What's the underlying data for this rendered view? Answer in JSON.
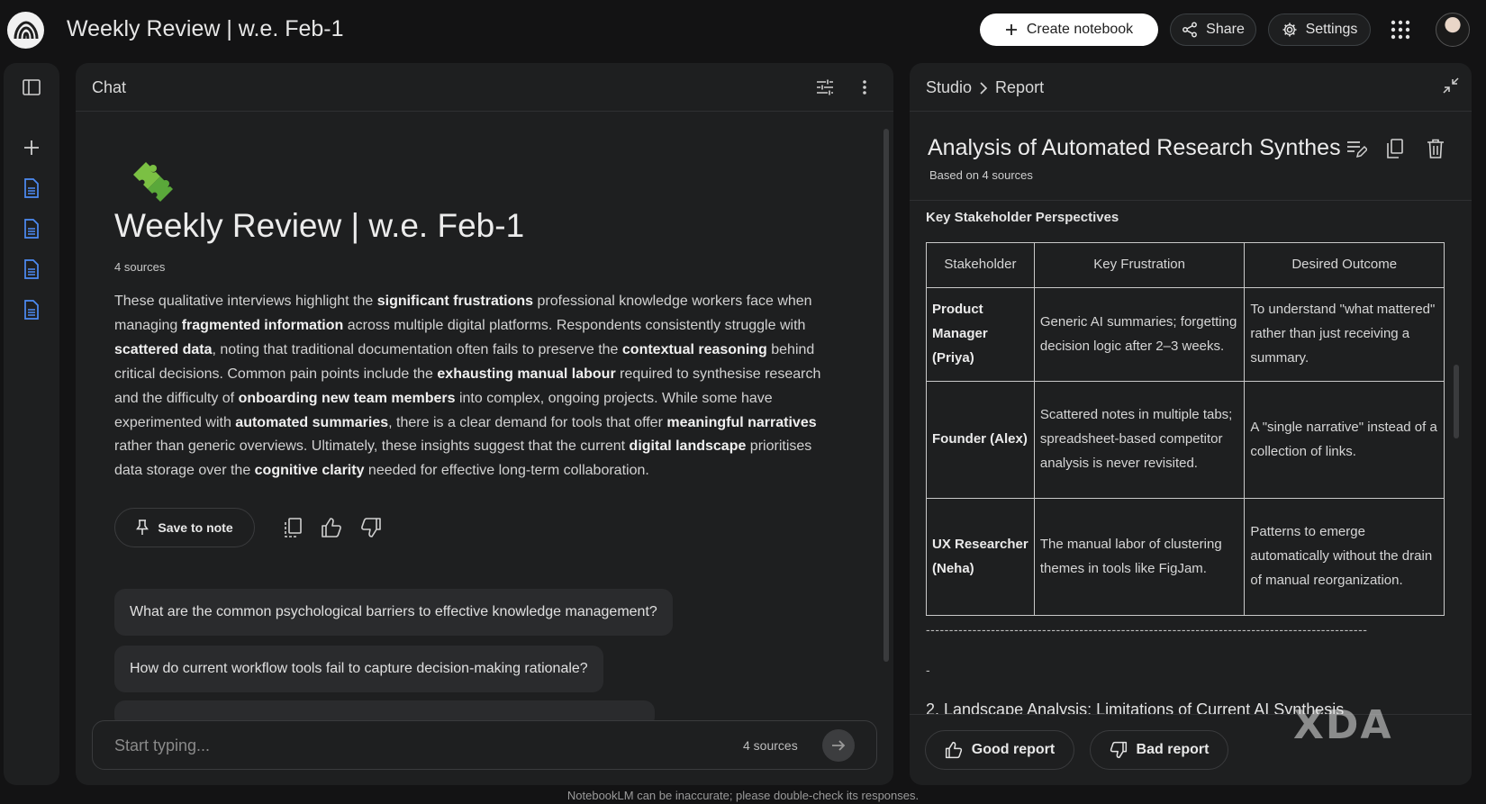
{
  "header": {
    "title": "Weekly Review |  w.e. Feb-1",
    "create_label": "Create notebook",
    "share_label": "Share",
    "settings_label": "Settings"
  },
  "chat": {
    "panel_title": "Chat",
    "notebook_title": "Weekly Review | w.e. Feb-1",
    "sources_count": "4 sources",
    "summary": [
      {
        "t": "These qualitative interviews highlight the "
      },
      {
        "t": "significant frustrations",
        "b": true
      },
      {
        "t": " professional knowledge workers face when managing "
      },
      {
        "t": "fragmented information",
        "b": true
      },
      {
        "t": " across multiple digital platforms. Respondents consistently struggle with "
      },
      {
        "t": "scattered data",
        "b": true
      },
      {
        "t": ", noting that traditional documentation often fails to preserve the "
      },
      {
        "t": "contextual reasoning",
        "b": true
      },
      {
        "t": " behind critical decisions. Common pain points include the "
      },
      {
        "t": "exhausting manual labour",
        "b": true
      },
      {
        "t": " required to synthesise research and the difficulty of "
      },
      {
        "t": "onboarding new team members",
        "b": true
      },
      {
        "t": " into complex, ongoing projects. While some have experimented with "
      },
      {
        "t": "automated summaries",
        "b": true
      },
      {
        "t": ", there is a clear demand for tools that offer "
      },
      {
        "t": "meaningful narratives",
        "b": true
      },
      {
        "t": " rather than generic overviews. Ultimately, these insights suggest that the current "
      },
      {
        "t": "digital landscape",
        "b": true
      },
      {
        "t": " prioritises data storage over the "
      },
      {
        "t": "cognitive clarity",
        "b": true
      },
      {
        "t": " needed for effective long-term collaboration."
      }
    ],
    "save_label": "Save to note",
    "suggestions": [
      "What are the common psychological barriers to effective knowledge management?",
      "How do current workflow tools fail to capture decision-making rationale?"
    ],
    "input_placeholder": "Start typing...",
    "input_sources": "4 sources"
  },
  "studio": {
    "crumb_root": "Studio",
    "crumb_current": "Report",
    "report_title": "Analysis of Automated Research Synthes",
    "based_on": "Based on 4 sources",
    "section_heading": "Key Stakeholder Perspectives",
    "table": {
      "headers": [
        "Stakeholder",
        "Key Frustration",
        "Desired Outcome"
      ],
      "rows": [
        [
          "Product Manager (Priya)",
          "Generic AI summaries; forgetting decision logic after 2–3 weeks.",
          "To understand \"what mattered\" rather than just receiving a summary."
        ],
        [
          "Founder (Alex)",
          "Scattered notes in multiple tabs; spreadsheet-based competitor analysis is never revisited.",
          "A \"single narrative\" instead of a collection of links."
        ],
        [
          "UX Researcher (Neha)",
          "The manual labor of clustering themes in tools like FigJam.",
          "Patterns to emerge automatically without the drain of manual reorganization."
        ]
      ]
    },
    "dash_line": "-----------------------------------------------------------------------------------------------",
    "dash_tail": "-",
    "section2": "2. Landscape Analysis: Limitations of Current AI Synthesis",
    "good_label": "Good report",
    "bad_label": "Bad report"
  },
  "watermark": "XDA",
  "disclaimer": "NotebookLM can be inaccurate; please double-check its responses.",
  "colors": {
    "background": "#131314",
    "panel": "#1e1f20",
    "source_icon": "#4d8cf5",
    "suggestion_bg": "#2a2b2d"
  },
  "icons": [
    "notebooklm-logo-icon",
    "plus-icon",
    "share-icon",
    "gear-icon",
    "apps-grid-icon",
    "sidebar-toggle-icon",
    "document-icon",
    "tune-icon",
    "more-vert-icon",
    "pin-icon",
    "copy-icon",
    "thumbs-up-icon",
    "thumbs-down-icon",
    "send-arrow-icon",
    "chevron-right-icon",
    "collapse-icon",
    "edit-list-icon",
    "delete-icon"
  ]
}
